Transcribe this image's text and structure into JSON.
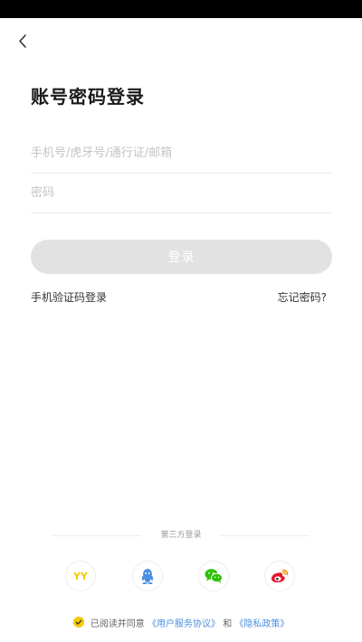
{
  "header": {
    "title": "账号密码登录"
  },
  "form": {
    "account_placeholder": "手机号/虎牙号/通行证/邮箱",
    "password_placeholder": "密码",
    "login_label": "登录"
  },
  "links": {
    "sms_login": "手机验证码登录",
    "forgot_password": "忘记密码?"
  },
  "third_party": {
    "label": "第三方登录",
    "providers": [
      {
        "name": "YY",
        "icon": "yy-icon",
        "text": "YY",
        "color": "#f5c800"
      },
      {
        "name": "QQ",
        "icon": "qq-penguin-icon",
        "color": "#4a90e2"
      },
      {
        "name": "WeChat",
        "icon": "wechat-icon",
        "color": "#2dc100"
      },
      {
        "name": "Weibo",
        "icon": "weibo-icon",
        "color": "#e6162d"
      }
    ]
  },
  "agreement": {
    "prefix": "已阅读并同意",
    "user_agreement": "《用户服务协议》",
    "conjunction": "和",
    "privacy_policy": "《隐私政策》",
    "checked": true
  },
  "colors": {
    "accent": "#f5c800",
    "link": "#4a8fe0",
    "button_disabled": "#e2e2e2"
  }
}
